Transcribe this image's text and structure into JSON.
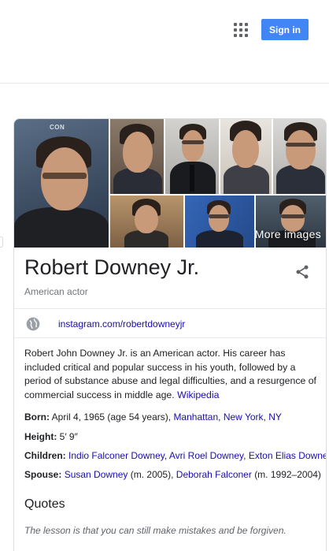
{
  "header": {
    "apps_icon": "apps-grid-icon",
    "signin_label": "Sign in",
    "signin_color": "#4285f4"
  },
  "images": {
    "more_label": "More images"
  },
  "entity": {
    "title": "Robert Downey Jr.",
    "subtitle": "American actor",
    "share_icon": "share-icon"
  },
  "profile": {
    "icon": "globe-icon",
    "link": "instagram.com/robertdowneyjr"
  },
  "description": {
    "text": "Robert John Downey Jr. is an American actor. His career has included critical and popular success in his youth, followed by a period of substance abuse and legal difficulties, and a resurgence of commercial success in middle age.",
    "source": "Wikipedia"
  },
  "facts": {
    "born": {
      "label": "Born:",
      "text": "April 4, 1965 (age 54 years),",
      "link1": "Manhattan",
      "sep": ",",
      "link2": "New York",
      "sep2": ",",
      "link3": "NY"
    },
    "height": {
      "label": "Height:",
      "text": "5′ 9″"
    },
    "children": {
      "label": "Children:",
      "link1": "Indio Falconer Downey",
      "sep": ",",
      "link2": "Avri Roel Downey",
      "sep2": ",",
      "link3": "Exton Elias Downey"
    },
    "spouse": {
      "label": "Spouse:",
      "link1": "Susan Downey",
      "text1": "(m. 2005),",
      "link2": "Deborah Falconer",
      "text2": "(m. 1992–2004)"
    }
  },
  "quotes": {
    "heading": "Quotes",
    "text": "The lesson is that you can still make mistakes and be forgiven."
  }
}
